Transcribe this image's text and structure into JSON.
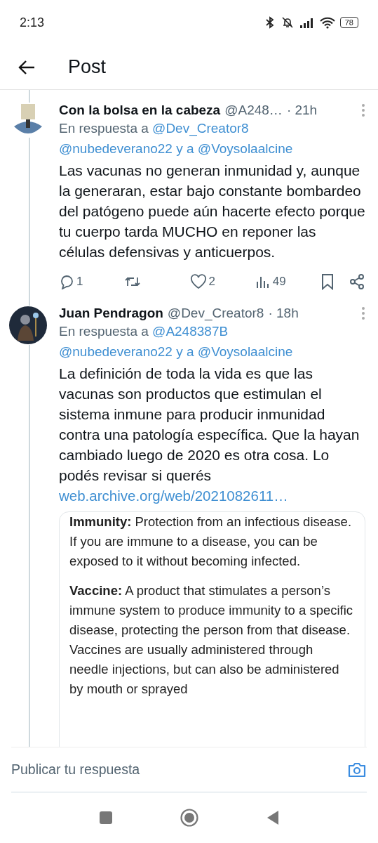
{
  "status_bar": {
    "time": "2:13",
    "battery": "78"
  },
  "header": {
    "title": "Post"
  },
  "posts": [
    {
      "name": "Con la bolsa en la cabeza",
      "handle": "@A248…",
      "time": "· 21h",
      "reply_prefix": "En respuesta a",
      "mentions": [
        "@Dev_Creator8",
        "@nubedeverano22",
        "@Voysolaalcine"
      ],
      "joiner": "y a",
      "text": "Las vacunas no generan inmunidad y, aunque la generaran, estar bajo constante bombardeo del patógeno puede aún hacerte efecto porque tu cuerpo tarda MUCHO en reponer las células defensivas y anticuerpos.",
      "metrics": {
        "replies": "1",
        "likes": "2",
        "views": "49"
      }
    },
    {
      "name": "Juan Pendragon",
      "handle": "@Dev_Creator8",
      "time": "· 18h",
      "reply_prefix": "En respuesta a",
      "mentions": [
        "@A248387B",
        "@nubedeverano22",
        "@Voysolaalcine"
      ],
      "joiner": "y a",
      "text": "La definición de toda la vida es que las vacunas son productos que estimulan el sistema inmune para producir inmunidad contra una patología específica. Que la hayan cambiado luego de 2020 es otra cosa. Lo podés revisar si querés",
      "link": "web.archive.org/web/2021082611…",
      "embed": [
        "**Immunity:** Protection from an infectious disease. If you are immune to a disease, you can be exposed to it without becoming infected.",
        "**Vaccine:** A product that stimulates a person’s immune system to produce immunity to a specific disease, protecting the person from that disease. Vaccines are usually administered through needle injections, but can also be administered by mouth or sprayed"
      ]
    }
  ],
  "reply_field": {
    "placeholder": "Publicar tu respuesta"
  }
}
